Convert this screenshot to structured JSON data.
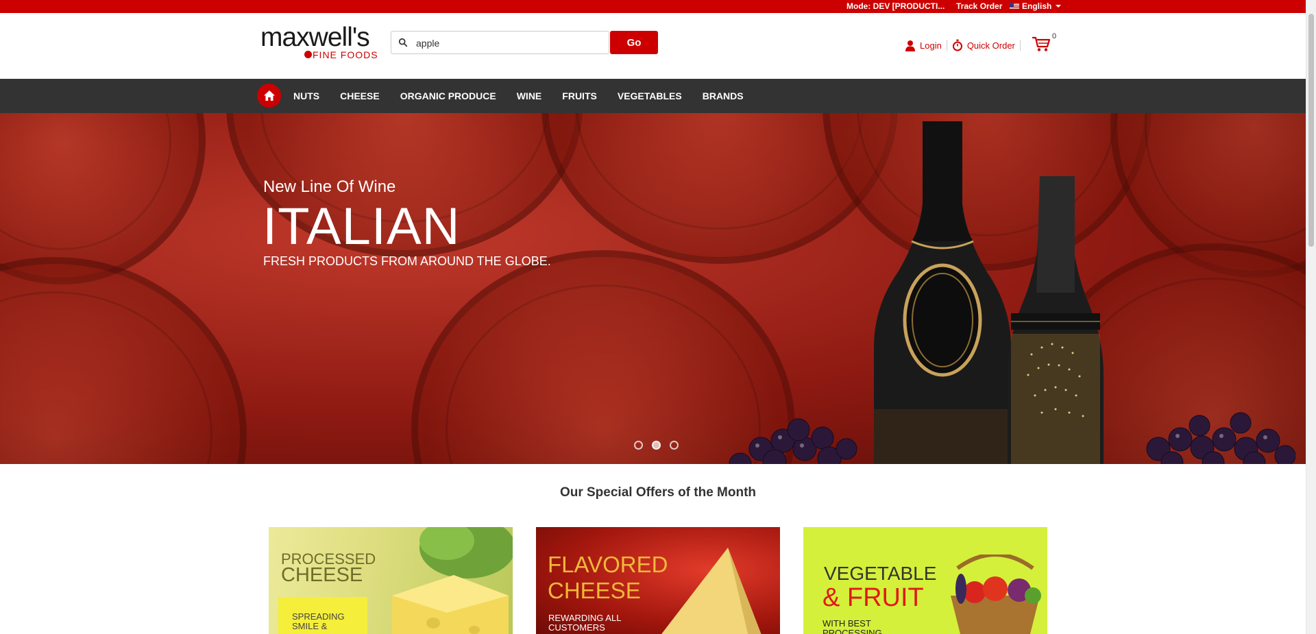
{
  "topbar": {
    "mode": "Mode: DEV [PRODUCTI...",
    "track_order": "Track Order",
    "language": "English"
  },
  "header": {
    "logo_name": "maxwell's",
    "logo_sub": "FINE FOODS",
    "search_value": "apple",
    "go_label": "Go",
    "login_label": "Login",
    "quick_order_label": "Quick Order",
    "cart_count": "0"
  },
  "nav": {
    "items": [
      "NUTS",
      "CHEESE",
      "ORGANIC PRODUCE",
      "WINE",
      "FRUITS",
      "VEGETABLES",
      "BRANDS"
    ]
  },
  "hero": {
    "subtitle": "New Line Of Wine",
    "title": "ITALIAN",
    "tagline": "FRESH PRODUCTS FROM AROUND THE GLOBE.",
    "slide_count": 3,
    "active_slide": 2
  },
  "offers": {
    "title": "Our Special Offers of the Month",
    "cards": [
      {
        "line1": "PROCESSED",
        "line2": "CHEESE",
        "small": "SPREADING SMILE &"
      },
      {
        "line1": "FLAVORED",
        "line2": "CHEESE",
        "small": "REWARDING ALL CUSTOMERS"
      },
      {
        "line1": "VEGETABLE",
        "line2": "& FRUIT",
        "small": "WITH BEST PROCESSING"
      }
    ]
  },
  "colors": {
    "brand_red": "#cc0000",
    "nav_bg": "#333333"
  }
}
